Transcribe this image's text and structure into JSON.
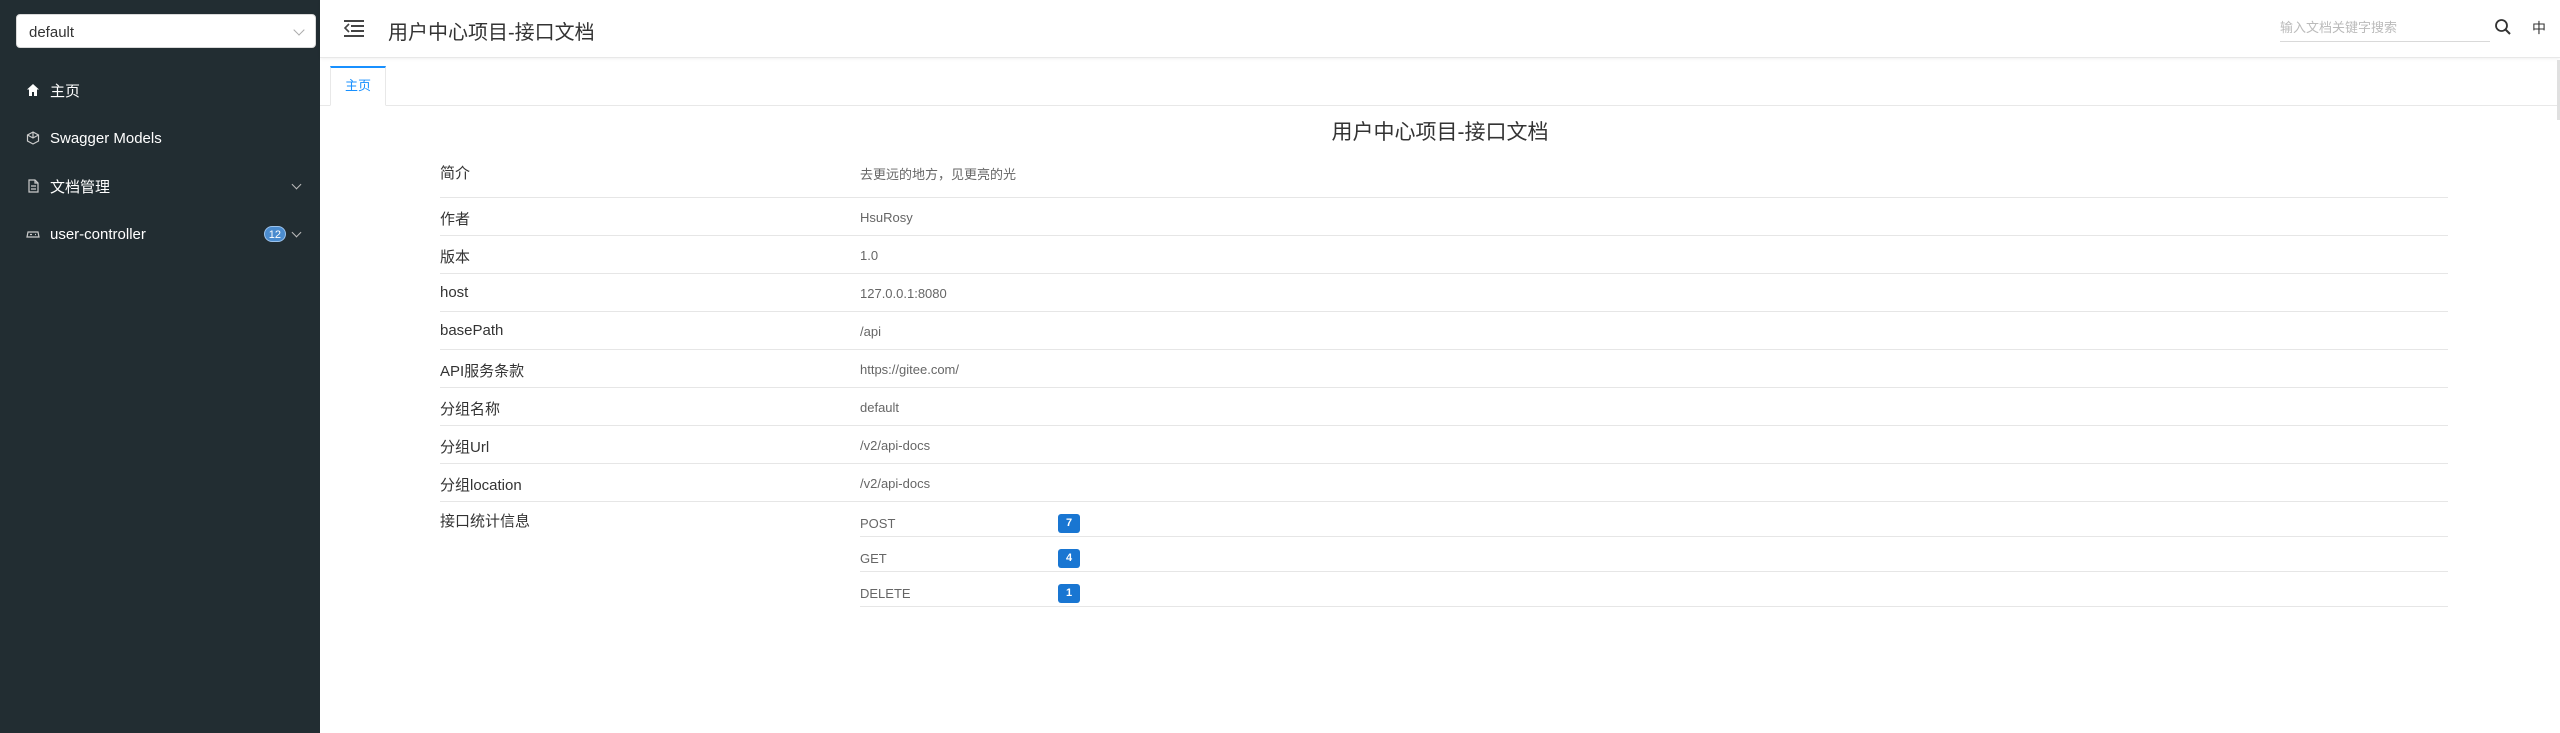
{
  "sidebar": {
    "group_select": {
      "value": "default"
    },
    "items": [
      {
        "label": "主页",
        "icon": "home-icon"
      },
      {
        "label": "Swagger Models",
        "icon": "model-icon"
      },
      {
        "label": "文档管理",
        "icon": "document-icon",
        "expandable": true
      },
      {
        "label": "user-controller",
        "icon": "controller-icon",
        "badge": "12",
        "expandable": true
      }
    ]
  },
  "header": {
    "title": "用户中心项目-接口文档",
    "search_placeholder": "输入文档关键字搜索",
    "lang": "中"
  },
  "tabs": [
    {
      "label": "主页",
      "active": true
    }
  ],
  "main": {
    "title": "用户中心项目-接口文档",
    "info": [
      {
        "key": "简介",
        "value": "去更远的地方，见更亮的光"
      },
      {
        "key": "作者",
        "value": "HsuRosy"
      },
      {
        "key": "版本",
        "value": "1.0"
      },
      {
        "key": "host",
        "value": "127.0.0.1:8080"
      },
      {
        "key": "basePath",
        "value": "/api"
      },
      {
        "key": "API服务条款",
        "value": "https://gitee.com/"
      },
      {
        "key": "分组名称",
        "value": "default"
      },
      {
        "key": "分组Url",
        "value": "/v2/api-docs"
      },
      {
        "key": "分组location",
        "value": "/v2/api-docs"
      }
    ],
    "stats_label": "接口统计信息",
    "stats": [
      {
        "method": "POST",
        "count": "7"
      },
      {
        "method": "GET",
        "count": "4"
      },
      {
        "method": "DELETE",
        "count": "1"
      }
    ]
  },
  "colors": {
    "sidebar_bg": "#222d32",
    "accent": "#1890ff",
    "badge": "#1976d2"
  }
}
